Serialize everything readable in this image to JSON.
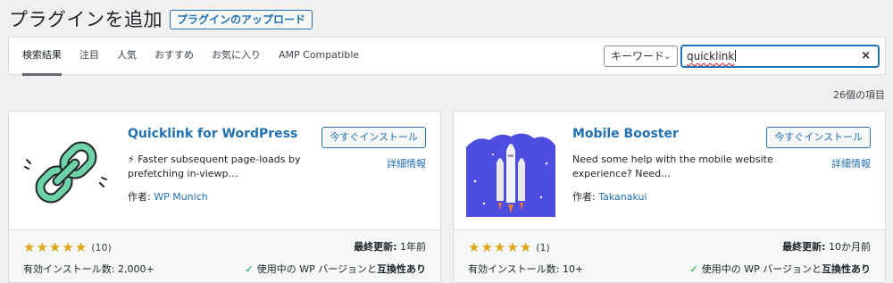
{
  "header": {
    "title": "プラグインを追加",
    "upload_label": "プラグインのアップロード"
  },
  "tabs": [
    {
      "label": "検索結果"
    },
    {
      "label": "注目"
    },
    {
      "label": "人気"
    },
    {
      "label": "おすすめ"
    },
    {
      "label": "お気に入り"
    },
    {
      "label": "AMP Compatible"
    }
  ],
  "search": {
    "type_label": "キーワード",
    "value": "quicklink",
    "clear_glyph": "×"
  },
  "result_count": "26個の項目",
  "plugins": [
    {
      "name": "Quicklink for WordPress",
      "icon": "chain-link-icon",
      "description": "⚡ Faster subsequent page-loads by prefetching in-viewp…",
      "author_prefix": "作者: ",
      "author": "WP Munich",
      "install_label": "今すぐインストール",
      "details_label": "詳細情報",
      "rating": 5,
      "rating_count": "(10)",
      "installs": "有効インストール数: 2,000+",
      "updated_label": "最終更新:",
      "updated_value": " 1年前",
      "compat_prefix": "使用中の WP バージョンと",
      "compat_bold": "互換性あり"
    },
    {
      "name": "Mobile Booster",
      "icon": "rocket-icon",
      "description": "Need some help with the mobile website experience? Need…",
      "author_prefix": "作者: ",
      "author": "Takanakui",
      "install_label": "今すぐインストール",
      "details_label": "詳細情報",
      "rating": 5,
      "rating_count": "(1)",
      "installs": "有効インストール数: 10+",
      "updated_label": "最終更新:",
      "updated_value": " 10か月前",
      "compat_prefix": "使用中の WP バージョンと",
      "compat_bold": "互換性あり"
    }
  ],
  "colors": {
    "accent": "#2271b1",
    "star": "#dba617",
    "check": "#00a32a",
    "chain": "#6fd3a8",
    "rocket_bg": "#4d4de0"
  }
}
